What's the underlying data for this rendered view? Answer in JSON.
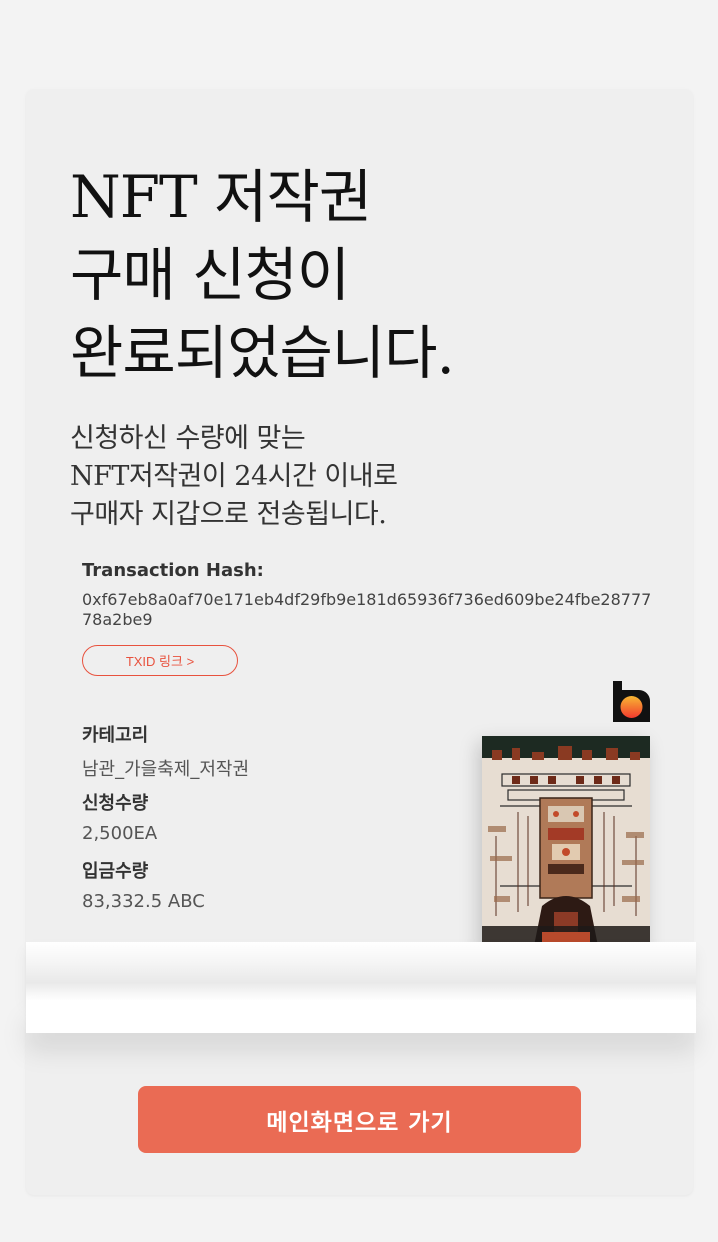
{
  "headline": {
    "line1": "NFT 저작권",
    "line2": "구매 신청이",
    "line3": "완료되었습니다."
  },
  "subtext": {
    "line1": "신청하신 수량에 맞는",
    "line2": "NFT저작권이 24시간 이내로",
    "line3": "구매자 지갑으로 전송됩니다."
  },
  "transaction": {
    "label": "Transaction Hash:",
    "hash": "0xf67eb8a0af70e171eb4df29fb9e181d65936f736ed609be24fbe2877778a2be9",
    "txid_button": "TXID 링크 >"
  },
  "details": {
    "category_label": "카테고리",
    "category_value": "남관_가을축제_저작권",
    "quantity_label": "신청수량",
    "quantity_value": "2,500EA",
    "deposit_label": "입금수량",
    "deposit_value": "83,332.5 ABC"
  },
  "icons": {
    "brand_logo": "brand-logo-icon"
  },
  "colors": {
    "accent": "#ea6b54",
    "txid_border": "#e8523e",
    "card_bg": "#efefef"
  },
  "main_button": "메인화면으로 가기"
}
